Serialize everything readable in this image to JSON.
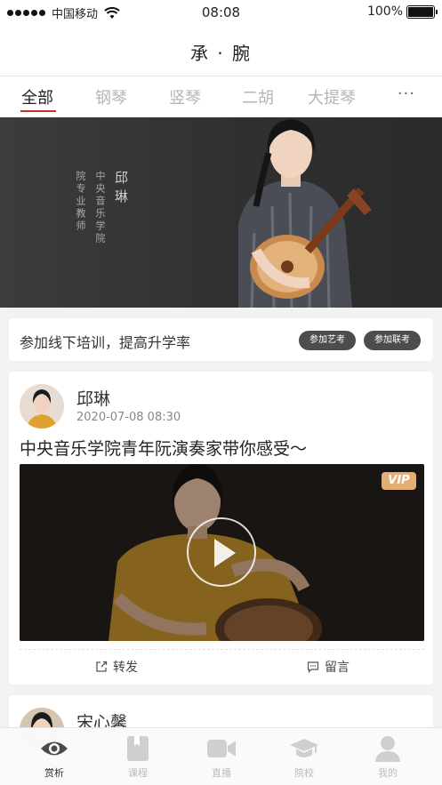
{
  "status_bar": {
    "carrier": "中国移动",
    "time": "08:08",
    "battery": "100%",
    "battery_level": 1.0
  },
  "header": {
    "title": "承 · 腕"
  },
  "tabs": {
    "items": [
      {
        "label": "全部",
        "active": true
      },
      {
        "label": "钢琴",
        "active": false
      },
      {
        "label": "竖琴",
        "active": false
      },
      {
        "label": "二胡",
        "active": false
      },
      {
        "label": "大提琴",
        "active": false
      }
    ],
    "more": "···"
  },
  "banner": {
    "name": "邱琳",
    "line1": "中央音乐学院",
    "line2": "院专业教师",
    "pages": 5,
    "current_page": 1
  },
  "promo": {
    "text": "参加线下培训，提高升学率",
    "buttons": [
      "参加艺考",
      "参加联考"
    ]
  },
  "post": {
    "author": "邱琳",
    "date": "2020-07-08  08:30",
    "title": "中央音乐学院青年阮演奏家带你感受～",
    "vip_badge": "VIP",
    "share_label": "转发",
    "comment_label": "留言"
  },
  "post2": {
    "author": "宋心馨"
  },
  "tabbar": {
    "items": [
      {
        "label": "赏析",
        "icon": "eye-icon",
        "active": true
      },
      {
        "label": "课程",
        "icon": "book-icon",
        "active": false
      },
      {
        "label": "直播",
        "icon": "video-camera-icon",
        "active": false
      },
      {
        "label": "院校",
        "icon": "graduation-cap-icon",
        "active": false
      },
      {
        "label": "我的",
        "icon": "user-icon",
        "active": false
      }
    ]
  },
  "colors": {
    "accent": "#c0322b",
    "inactive": "#bbbbbb",
    "vip": "#e3ad73",
    "pill": "#4d4d4d"
  }
}
